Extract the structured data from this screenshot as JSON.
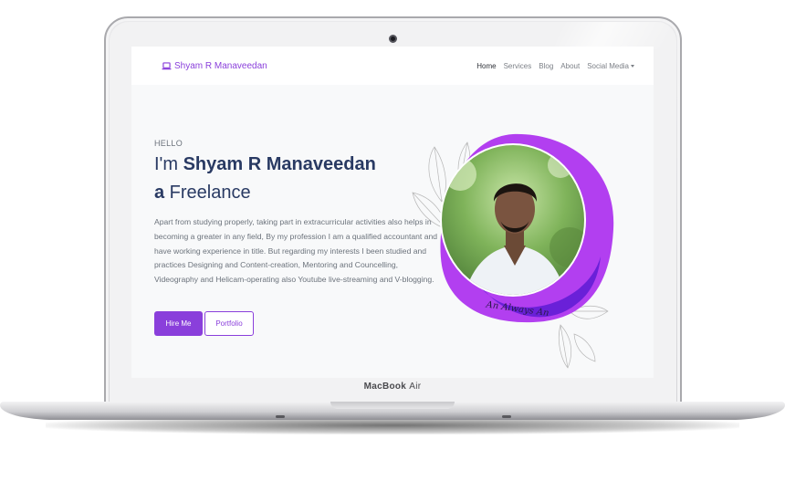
{
  "device": {
    "brand": "MacBook",
    "model": "Air"
  },
  "navbar": {
    "brand": "Shyam R Manaveedan",
    "brand_icon": "laptop-icon",
    "links": [
      "Home",
      "Services",
      "Blog",
      "About",
      "Social Media"
    ],
    "active_link": "Home"
  },
  "hero": {
    "greeting": "HELLO",
    "headline_prefix": "I'm ",
    "name": "Shyam R Manaveedan",
    "role_prefix": "a",
    "role": " Freelance",
    "bio": "Apart from studying properly, taking part in extracurricular activities also helps in becoming a greater in any field, By my profession I am a qualified accountant and have working experience in title. But regarding my interests I been studied and practices Designing and Content-creation, Mentoring and Councelling, Videography and Helicam-operating also Youtube live-streaming and V-blogging.",
    "primary_button": "Hire Me",
    "secondary_button": "Portfolio",
    "signature": "An Always An"
  },
  "colors": {
    "accent": "#8a3fdb",
    "heading": "#293a63",
    "blob_light": "#b23ff0",
    "blob_dark": "#6a20d8"
  }
}
